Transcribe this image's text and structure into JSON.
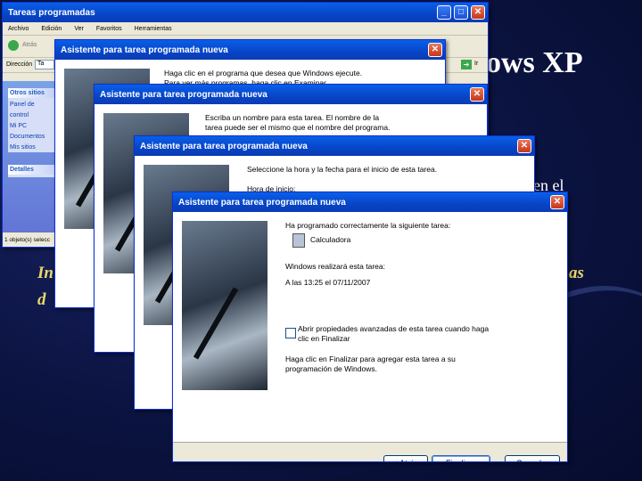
{
  "slide": {
    "title_partial": "ows XP",
    "body_partial": "en el",
    "italic_line1_left": "In",
    "italic_line1_right": "as",
    "italic_line2_left": "d"
  },
  "explorer": {
    "title": "Tareas programadas",
    "menu": [
      "Archivo",
      "Edición",
      "Ver",
      "Favoritos",
      "Herramientas"
    ],
    "back_label": "Atrás",
    "address_label": "Dirección",
    "address_value": "Ta",
    "go_label": "Ir",
    "panels": [
      {
        "head": "Otros sitios",
        "items": [
          "Panel de control",
          "Mi PC",
          "Documentos",
          "Mis sitios"
        ]
      },
      {
        "head": "Detalles",
        "items": []
      }
    ],
    "status": "1 objeto(s) selecc"
  },
  "wizard1": {
    "title": "Asistente para tarea programada nueva",
    "text": "Haga clic en el programa que desea que Windows ejecute. Para ver más programas, haga clic en Examinar."
  },
  "wizard2": {
    "title": "Asistente para tarea programada nueva",
    "text": "Escriba un nombre para esta tarea. El nombre de la tarea puede ser el mismo que el nombre del programa."
  },
  "wizard3": {
    "title": "Asistente para tarea programada nueva",
    "text": "Seleccione la hora y la fecha para el inicio de esta tarea.",
    "start_label": "Hora de inicio:"
  },
  "wizard4": {
    "title": "Asistente para tarea programada nueva",
    "scheduled_text": "Ha programado correctamente la siguiente tarea:",
    "task_name": "Calculadora",
    "runs_label": "Windows realizará esta tarea:",
    "runs_value": "A las 13:25 el 07/11/2007",
    "advanced_checkbox": "Abrir propiedades avanzadas de esta tarea cuando haga clic en Finalizar",
    "finish_hint": "Haga clic en Finalizar para agregar esta tarea a su programación de Windows.",
    "back_button": "< Atrás",
    "finish_button": "Finalizar",
    "cancel_button": "Cancelar"
  }
}
